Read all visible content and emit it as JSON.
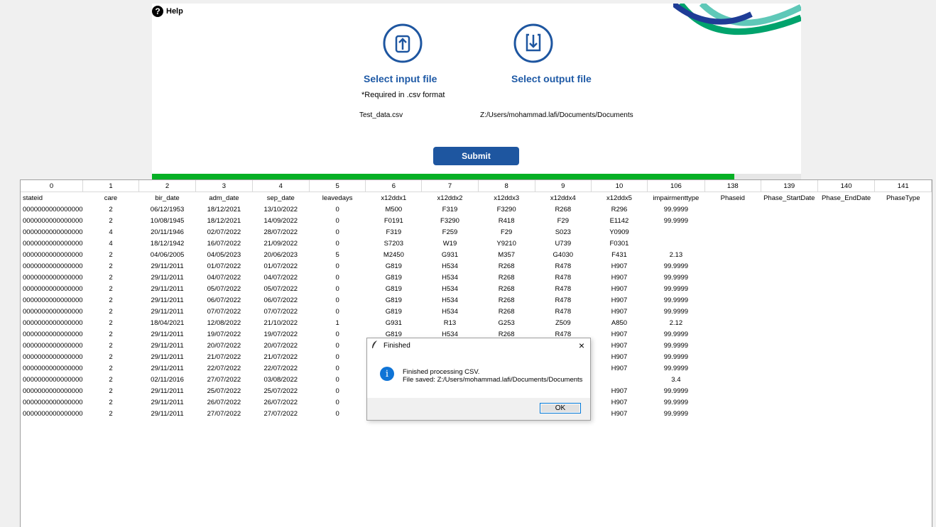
{
  "header": {
    "help_label": "Help",
    "help_icon_glyph": "?",
    "input_label": "Select input file",
    "input_note": "*Required in .csv format",
    "input_filename": "Test_data.csv",
    "output_label": "Select output file",
    "output_path": "Z:/Users/mohammad.lafi/Documents/Documents",
    "submit_label": "Submit"
  },
  "progress": {
    "value": 0.897
  },
  "colors": {
    "brand_blue": "#1e56a0",
    "progress_green": "#06b025",
    "wave_green": "#00a36c",
    "wave_teal": "#5fc8b8",
    "wave_blue": "#1e3c96"
  },
  "table": {
    "index_headers": [
      "0",
      "1",
      "2",
      "3",
      "4",
      "5",
      "6",
      "7",
      "8",
      "9",
      "10",
      "106",
      "138",
      "139",
      "140",
      "141"
    ],
    "column_names": [
      "stateid",
      "care",
      "bir_date",
      "adm_date",
      "sep_date",
      "leavedays",
      "x12ddx1",
      "x12ddx2",
      "x12ddx3",
      "x12ddx4",
      "x12ddx5",
      "impairmenttype",
      "Phaseid",
      "Phase_StartDate",
      "Phase_EndDate",
      "PhaseType"
    ],
    "rows": [
      [
        "0000000000000000",
        "2",
        "06/12/1953",
        "18/12/2021",
        "13/10/2022",
        "0",
        "M500",
        "F319",
        "F3290",
        "R268",
        "R296",
        "99.9999",
        "",
        "",
        "",
        ""
      ],
      [
        "0000000000000000",
        "2",
        "10/08/1945",
        "18/12/2021",
        "14/09/2022",
        "0",
        "F0191",
        "F3290",
        "R418",
        "F29",
        "E1142",
        "99.9999",
        "",
        "",
        "",
        ""
      ],
      [
        "0000000000000000",
        "4",
        "20/11/1946",
        "02/07/2022",
        "28/07/2022",
        "0",
        "F319",
        "F259",
        "F29",
        "S023",
        "Y0909",
        "",
        "",
        "",
        "",
        ""
      ],
      [
        "0000000000000000",
        "4",
        "18/12/1942",
        "16/07/2022",
        "21/09/2022",
        "0",
        "S7203",
        "W19",
        "Y9210",
        "U739",
        "F0301",
        "",
        "",
        "",
        "",
        ""
      ],
      [
        "0000000000000000",
        "2",
        "04/06/2005",
        "04/05/2023",
        "20/06/2023",
        "5",
        "M2450",
        "G931",
        "M357",
        "G4030",
        "F431",
        "2.13",
        "",
        "",
        "",
        ""
      ],
      [
        "0000000000000000",
        "2",
        "29/11/2011",
        "01/07/2022",
        "01/07/2022",
        "0",
        "G819",
        "H534",
        "R268",
        "R478",
        "H907",
        "99.9999",
        "",
        "",
        "",
        ""
      ],
      [
        "0000000000000000",
        "2",
        "29/11/2011",
        "04/07/2022",
        "04/07/2022",
        "0",
        "G819",
        "H534",
        "R268",
        "R478",
        "H907",
        "99.9999",
        "",
        "",
        "",
        ""
      ],
      [
        "0000000000000000",
        "2",
        "29/11/2011",
        "05/07/2022",
        "05/07/2022",
        "0",
        "G819",
        "H534",
        "R268",
        "R478",
        "H907",
        "99.9999",
        "",
        "",
        "",
        ""
      ],
      [
        "0000000000000000",
        "2",
        "29/11/2011",
        "06/07/2022",
        "06/07/2022",
        "0",
        "G819",
        "H534",
        "R268",
        "R478",
        "H907",
        "99.9999",
        "",
        "",
        "",
        ""
      ],
      [
        "0000000000000000",
        "2",
        "29/11/2011",
        "07/07/2022",
        "07/07/2022",
        "0",
        "G819",
        "H534",
        "R268",
        "R478",
        "H907",
        "99.9999",
        "",
        "",
        "",
        ""
      ],
      [
        "0000000000000000",
        "2",
        "18/04/2021",
        "12/08/2022",
        "21/10/2022",
        "1",
        "G931",
        "R13",
        "G253",
        "Z509",
        "A850",
        "2.12",
        "",
        "",
        "",
        ""
      ],
      [
        "0000000000000000",
        "2",
        "29/11/2011",
        "19/07/2022",
        "19/07/2022",
        "0",
        "G819",
        "H534",
        "R268",
        "R478",
        "H907",
        "99.9999",
        "",
        "",
        "",
        ""
      ],
      [
        "0000000000000000",
        "2",
        "29/11/2011",
        "20/07/2022",
        "20/07/2022",
        "0",
        "",
        "",
        "",
        "",
        "H907",
        "99.9999",
        "",
        "",
        "",
        ""
      ],
      [
        "0000000000000000",
        "2",
        "29/11/2011",
        "21/07/2022",
        "21/07/2022",
        "0",
        "",
        "",
        "",
        "",
        "H907",
        "99.9999",
        "",
        "",
        "",
        ""
      ],
      [
        "0000000000000000",
        "2",
        "29/11/2011",
        "22/07/2022",
        "22/07/2022",
        "0",
        "",
        "",
        "",
        "",
        "H907",
        "99.9999",
        "",
        "",
        "",
        ""
      ],
      [
        "0000000000000000",
        "2",
        "02/11/2016",
        "27/07/2022",
        "03/08/2022",
        "0",
        "",
        "",
        "",
        "",
        "",
        "3.4",
        "",
        "",
        "",
        ""
      ],
      [
        "0000000000000000",
        "2",
        "29/11/2011",
        "25/07/2022",
        "25/07/2022",
        "0",
        "",
        "",
        "",
        "",
        "H907",
        "99.9999",
        "",
        "",
        "",
        ""
      ],
      [
        "0000000000000000",
        "2",
        "29/11/2011",
        "26/07/2022",
        "26/07/2022",
        "0",
        "",
        "",
        "",
        "",
        "H907",
        "99.9999",
        "",
        "",
        "",
        ""
      ],
      [
        "0000000000000000",
        "2",
        "29/11/2011",
        "27/07/2022",
        "27/07/2022",
        "0",
        "",
        "",
        "",
        "",
        "H907",
        "99.9999",
        "",
        "",
        "",
        ""
      ]
    ]
  },
  "dialog": {
    "title": "Finished",
    "close_glyph": "×",
    "info_glyph": "i",
    "message_line1": "Finished processing CSV.",
    "message_line2": "File saved: Z:/Users/mohammad.lafi/Documents/Documents",
    "ok_label": "OK"
  }
}
